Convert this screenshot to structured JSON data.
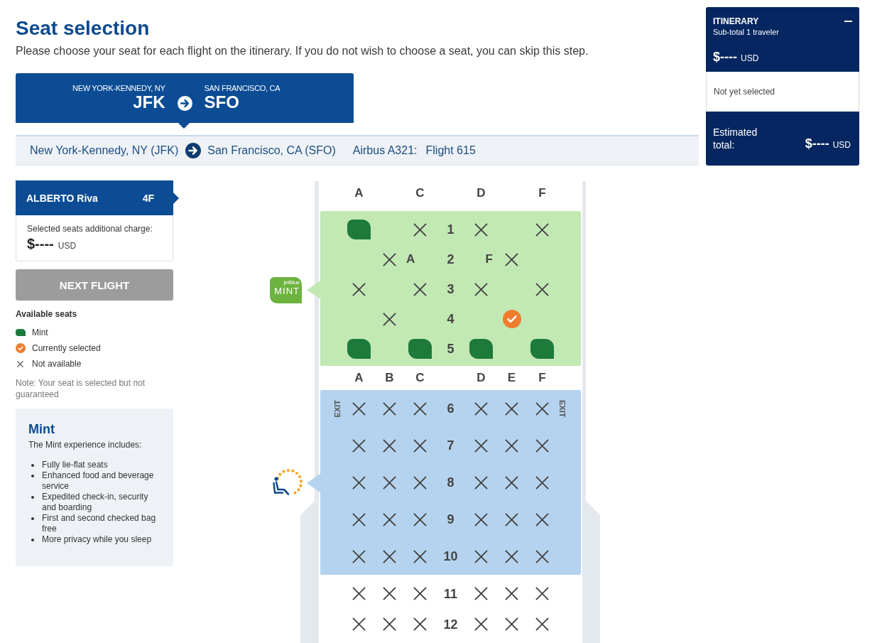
{
  "header": {
    "title": "Seat selection",
    "subtitle": "Please choose your seat for each flight on the itinerary. If you do not wish to choose a seat, you can skip this step."
  },
  "route_card": {
    "selected": true,
    "origin": {
      "city": "NEW YORK-KENNEDY, NY",
      "code": "JFK"
    },
    "destination": {
      "city": "SAN FRANCISCO, CA",
      "code": "SFO"
    }
  },
  "flight_bar": {
    "origin": "New York-Kennedy, NY (JFK)",
    "destination": "San Francisco, CA (SFO)",
    "aircraft": "Airbus A321:",
    "flight": "Flight 615"
  },
  "passenger": {
    "name": "ALBERTO Riva",
    "seat": "4F",
    "selected": true
  },
  "charge": {
    "label": "Selected seats additional charge:",
    "amount": "$----",
    "currency": "USD"
  },
  "next_button": {
    "label": "NEXT FLIGHT",
    "disabled": true
  },
  "legend": {
    "title": "Available seats",
    "items": [
      {
        "kind": "mint",
        "label": "Mint"
      },
      {
        "kind": "selected",
        "label": "Currently selected"
      },
      {
        "kind": "unavailable",
        "label": "Not available"
      }
    ]
  },
  "note": "Note: Your seat is selected but not guaranteed",
  "info_box": {
    "title": "Mint",
    "intro": "The Mint experience includes:",
    "items": [
      "Fully lie-flat seats",
      "Enhanced food and beverage service",
      "Expedited check-in, security and boarding",
      "First and second checked bag free",
      "More privacy while you sleep"
    ]
  },
  "seat_map": {
    "sections": [
      {
        "kind": "header",
        "left": [
          {
            "kind": "letter",
            "text": "A"
          },
          {
            "kind": "gap"
          },
          {
            "kind": "letter",
            "text": "C"
          }
        ],
        "right": [
          {
            "kind": "letter",
            "text": "D"
          },
          {
            "kind": "gap"
          },
          {
            "kind": "letter",
            "text": "F"
          }
        ]
      },
      {
        "kind": "mint",
        "color": "#c2e8b4",
        "badge": {
          "brand": "jetBlue",
          "label": "MINT"
        },
        "rows": [
          {
            "number": "1",
            "left": [
              {
                "kind": "seat",
                "available": true,
                "selected": false
              },
              {
                "kind": "gap"
              },
              {
                "kind": "seat",
                "available": false,
                "selected": false
              }
            ],
            "right": [
              {
                "kind": "seat",
                "available": false,
                "selected": false
              },
              {
                "kind": "gap"
              },
              {
                "kind": "seat",
                "available": false,
                "selected": false
              }
            ]
          },
          {
            "number": "2",
            "left": [
              {
                "kind": "gap"
              },
              {
                "kind": "seat",
                "available": false,
                "selected": false
              },
              {
                "kind": "letter",
                "text": "A"
              }
            ],
            "right": [
              {
                "kind": "letter",
                "text": "F"
              },
              {
                "kind": "seat",
                "available": false,
                "selected": false
              },
              {
                "kind": "gap"
              }
            ]
          },
          {
            "number": "3",
            "left": [
              {
                "kind": "seat",
                "available": false,
                "selected": false
              },
              {
                "kind": "gap"
              },
              {
                "kind": "seat",
                "available": false,
                "selected": false
              }
            ],
            "right": [
              {
                "kind": "seat",
                "available": false,
                "selected": false
              },
              {
                "kind": "gap"
              },
              {
                "kind": "seat",
                "available": false,
                "selected": false
              }
            ]
          },
          {
            "number": "4",
            "left": [
              {
                "kind": "gap"
              },
              {
                "kind": "seat",
                "available": false,
                "selected": false
              },
              {
                "kind": "gap"
              }
            ],
            "right": [
              {
                "kind": "gap"
              },
              {
                "kind": "seat",
                "selected": true
              },
              {
                "kind": "gap"
              }
            ]
          },
          {
            "number": "5",
            "left": [
              {
                "kind": "seat",
                "available": true,
                "selected": false
              },
              {
                "kind": "gap"
              },
              {
                "kind": "seat",
                "available": true,
                "selected": false
              }
            ],
            "right": [
              {
                "kind": "seat",
                "available": true,
                "selected": false
              },
              {
                "kind": "gap"
              },
              {
                "kind": "seat",
                "available": true,
                "selected": false
              }
            ]
          }
        ]
      },
      {
        "kind": "header",
        "left": [
          {
            "kind": "letter",
            "text": "A"
          },
          {
            "kind": "letter",
            "text": "B"
          },
          {
            "kind": "letter",
            "text": "C"
          }
        ],
        "right": [
          {
            "kind": "letter",
            "text": "D"
          },
          {
            "kind": "letter",
            "text": "E"
          },
          {
            "kind": "letter",
            "text": "F"
          }
        ]
      },
      {
        "kind": "recline",
        "color": "#b5d3ee",
        "rows": [
          {
            "number": "6",
            "exit_left": "EXIT",
            "exit_right": "EXIT",
            "left": [
              {
                "kind": "seat",
                "available": false,
                "selected": false
              },
              {
                "kind": "seat",
                "available": false,
                "selected": false
              },
              {
                "kind": "seat",
                "available": false,
                "selected": false
              }
            ],
            "right": [
              {
                "kind": "seat",
                "available": false,
                "selected": false
              },
              {
                "kind": "seat",
                "available": false,
                "selected": false
              },
              {
                "kind": "seat",
                "available": false,
                "selected": false
              }
            ]
          },
          {
            "number": "7",
            "left": [
              {
                "kind": "seat",
                "available": false,
                "selected": false
              },
              {
                "kind": "seat",
                "available": false,
                "selected": false
              },
              {
                "kind": "seat",
                "available": false,
                "selected": false
              }
            ],
            "right": [
              {
                "kind": "seat",
                "available": false,
                "selected": false
              },
              {
                "kind": "seat",
                "available": false,
                "selected": false
              },
              {
                "kind": "seat",
                "available": false,
                "selected": false
              }
            ]
          },
          {
            "number": "8",
            "left": [
              {
                "kind": "seat",
                "available": false,
                "selected": false
              },
              {
                "kind": "seat",
                "available": false,
                "selected": false
              },
              {
                "kind": "seat",
                "available": false,
                "selected": false
              }
            ],
            "right": [
              {
                "kind": "seat",
                "available": false,
                "selected": false
              },
              {
                "kind": "seat",
                "available": false,
                "selected": false
              },
              {
                "kind": "seat",
                "available": false,
                "selected": false
              }
            ]
          },
          {
            "number": "9",
            "left": [
              {
                "kind": "seat",
                "available": false,
                "selected": false
              },
              {
                "kind": "seat",
                "available": false,
                "selected": false
              },
              {
                "kind": "seat",
                "available": false,
                "selected": false
              }
            ],
            "right": [
              {
                "kind": "seat",
                "available": false,
                "selected": false
              },
              {
                "kind": "seat",
                "available": false,
                "selected": false
              },
              {
                "kind": "seat",
                "available": false,
                "selected": false
              }
            ]
          },
          {
            "number": "10",
            "left": [
              {
                "kind": "seat",
                "available": false,
                "selected": false
              },
              {
                "kind": "seat",
                "available": false,
                "selected": false
              },
              {
                "kind": "seat",
                "available": false,
                "selected": false
              }
            ],
            "right": [
              {
                "kind": "seat",
                "available": false,
                "selected": false
              },
              {
                "kind": "seat",
                "available": false,
                "selected": false
              },
              {
                "kind": "seat",
                "available": false,
                "selected": false
              }
            ]
          }
        ]
      },
      {
        "kind": "plain",
        "rows": [
          {
            "number": "11",
            "left": [
              {
                "kind": "seat",
                "available": false,
                "selected": false
              },
              {
                "kind": "seat",
                "available": false,
                "selected": false
              },
              {
                "kind": "seat",
                "available": false,
                "selected": false
              }
            ],
            "right": [
              {
                "kind": "seat",
                "available": false,
                "selected": false
              },
              {
                "kind": "seat",
                "available": false,
                "selected": false
              },
              {
                "kind": "seat",
                "available": false,
                "selected": false
              }
            ]
          },
          {
            "number": "12",
            "left": [
              {
                "kind": "seat",
                "available": false,
                "selected": false
              },
              {
                "kind": "seat",
                "available": false,
                "selected": false
              },
              {
                "kind": "seat",
                "available": false,
                "selected": false
              }
            ],
            "right": [
              {
                "kind": "seat",
                "available": false,
                "selected": false
              },
              {
                "kind": "seat",
                "available": false,
                "selected": false
              },
              {
                "kind": "seat",
                "available": false,
                "selected": false
              }
            ]
          }
        ]
      }
    ]
  },
  "itinerary": {
    "title": "ITINERARY",
    "expanded": true,
    "subtitle": "Sub-total 1 traveler",
    "amount": "$----",
    "currency": "USD",
    "status": "Not yet selected",
    "total_label": "Estimated total:",
    "total_amount": "$----",
    "total_currency": "USD"
  }
}
